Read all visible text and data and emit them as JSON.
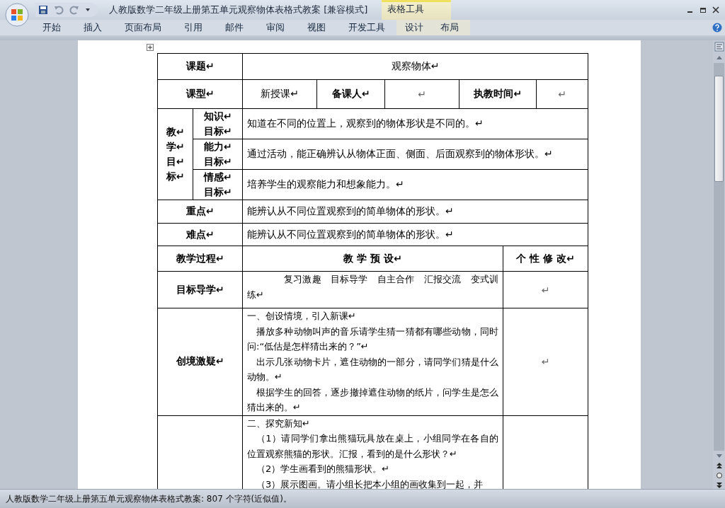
{
  "window": {
    "title": "人教版数学二年级上册第五单元观察物体表格式教案 [兼容模式]",
    "context_group": "表格工具"
  },
  "ribbon_tabs": [
    {
      "label": "开始",
      "selected": false,
      "kind": "main"
    },
    {
      "label": "插入",
      "selected": false,
      "kind": "main"
    },
    {
      "label": "页面布局",
      "selected": false,
      "kind": "main"
    },
    {
      "label": "引用",
      "selected": false,
      "kind": "main"
    },
    {
      "label": "邮件",
      "selected": false,
      "kind": "main"
    },
    {
      "label": "审阅",
      "selected": false,
      "kind": "main"
    },
    {
      "label": "视图",
      "selected": false,
      "kind": "main"
    },
    {
      "label": "开发工具",
      "selected": false,
      "kind": "main"
    },
    {
      "label": "设计",
      "selected": false,
      "kind": "context"
    },
    {
      "label": "布局",
      "selected": false,
      "kind": "context"
    }
  ],
  "lesson_plan": {
    "topic_label": "课题↵",
    "topic": "观察物体↵",
    "type_label": "课型↵",
    "type": "新授课↵",
    "preparer_label": "备课人↵",
    "preparer": "↵",
    "time_label": "执教时间↵",
    "time": "↵",
    "objectives_label": [
      "教↵",
      "学↵",
      "目↵",
      "标↵"
    ],
    "objectives": [
      {
        "label": [
          "知识↵",
          "目标↵"
        ],
        "text": "知道在不同的位置上，观察到的物体形状是不同的。↵"
      },
      {
        "label": [
          "能力↵",
          "目标↵"
        ],
        "text": "通过活动，能正确辨认从物体正面、侧面、后面观察到的物体形状。↵"
      },
      {
        "label": [
          "情感↵",
          "目标↵"
        ],
        "text": "培养学生的观察能力和想象能力。↵"
      }
    ],
    "key_point_label": "重点↵",
    "key_point": "能辨认从不同位置观察到的简单物体的形状。↵",
    "difficulty_label": "难点↵",
    "difficulty": "能辨认从不同位置观察到的简单物体的形状。↵",
    "process_headers": [
      "教学过程↵",
      "教 学 预 设↵",
      "个 性 修 改↵"
    ],
    "process_rows": [
      {
        "stage": "目标导学↵",
        "paragraphs": [
          {
            "text": "复习激趣　目标导学　自主合作　汇报交流　变式训练↵",
            "indented": true
          }
        ],
        "note": "↵"
      },
      {
        "stage": "创境激疑↵",
        "paragraphs": [
          {
            "text": "一、创设情境，引入新课↵",
            "indented": false
          },
          {
            "text": "播放多种动物叫声的音乐请学生猜一猜都有哪些动物，同时问:“低估是怎样猜出来的？”↵",
            "indented": true
          },
          {
            "text": "出示几张动物卡片，遮住动物的一部分，请同学们猜是什么动物。↵",
            "indented": true
          },
          {
            "text": "根据学生的回答，逐步撤掉遮住动物的纸片，问学生是怎么猜出来的。↵",
            "indented": true
          }
        ],
        "note": "↵"
      },
      {
        "stage": "",
        "paragraphs": [
          {
            "text": "二、探究新知↵",
            "indented": false
          },
          {
            "text": "（1）请同学们拿出熊猫玩具放在桌上，小组同学在各自的位置观察熊猫的形状。汇报，看到的是什么形状？↵",
            "indented": true
          },
          {
            "text": "（2）学生画看到的熊猫形状。↵",
            "indented": true
          },
          {
            "text": "（3）展示图画。请小组长把本小组的画收集到一起，并",
            "indented": true
          }
        ],
        "note": ""
      }
    ]
  },
  "status_bar": "人教版数学二年级上册第五单元观察物体表格式教案: 807 个字符(近似值)。"
}
